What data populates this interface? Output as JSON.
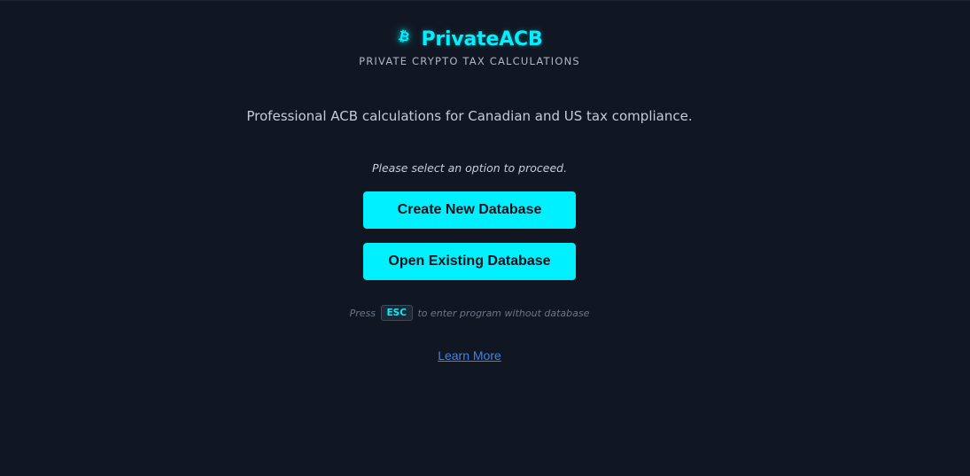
{
  "header": {
    "logo_glyph": "₿",
    "title": "PrivateACB",
    "subtitle": "PRIVATE CRYPTO TAX CALCULATIONS"
  },
  "main": {
    "tagline": "Professional ACB calculations for Canadian and US tax compliance.",
    "prompt": "Please select an option to proceed.",
    "buttons": {
      "create_label": "Create New Database",
      "open_label": "Open Existing Database"
    },
    "esc_hint": {
      "before": "Press",
      "key": "ESC",
      "after": "to enter program without database"
    },
    "learn_more_label": "Learn More"
  },
  "colors": {
    "background": "#111722",
    "accent": "#00f0ff",
    "link": "#3b82f6"
  },
  "icons": {
    "logo": "bitcoin-icon"
  }
}
